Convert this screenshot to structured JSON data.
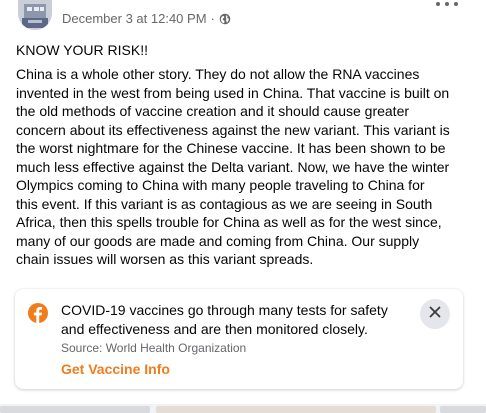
{
  "post": {
    "timestamp": "December 3 at 12:40 PM",
    "separator": "·",
    "privacy_icon": "globe-icon",
    "more_icon": "more-options-icon",
    "headline": "KNOW YOUR RISK!!",
    "body_lines": [
      "China is a whole other story.  They do not allow the RNA vaccines",
      "invented in the west from being used in China.  That vaccine is built on",
      "the old methods of vaccine creation and it should cause greater",
      "concern about its effectiveness against the new variant.  This variant is",
      "the worst nightmare for the Chinese vaccine.  It has been shown to be",
      "much less effective against the Delta variant.  Now, we have the winter",
      "Olympics coming to China with many people traveling to China for",
      "this event.  If this variant is as contagious as we are seeing in South",
      "Africa, then this spells trouble for China as well as for the west since,",
      "many of our goods are made and coming from China.  Our supply",
      "chain issues will worsen as this variant spreads."
    ]
  },
  "info_card": {
    "icon": "facebook-icon",
    "message_lines": [
      "COVID-19 vaccines go through many tests for safety",
      "and effectiveness and are then monitored closely."
    ],
    "source": "Source: World Health Organization",
    "link_label": "Get Vaccine Info",
    "close_icon": "close-icon",
    "colors": {
      "link": "#f07c1c",
      "icon": "#f07c1c",
      "close_bg": "#e4e6eb"
    }
  }
}
